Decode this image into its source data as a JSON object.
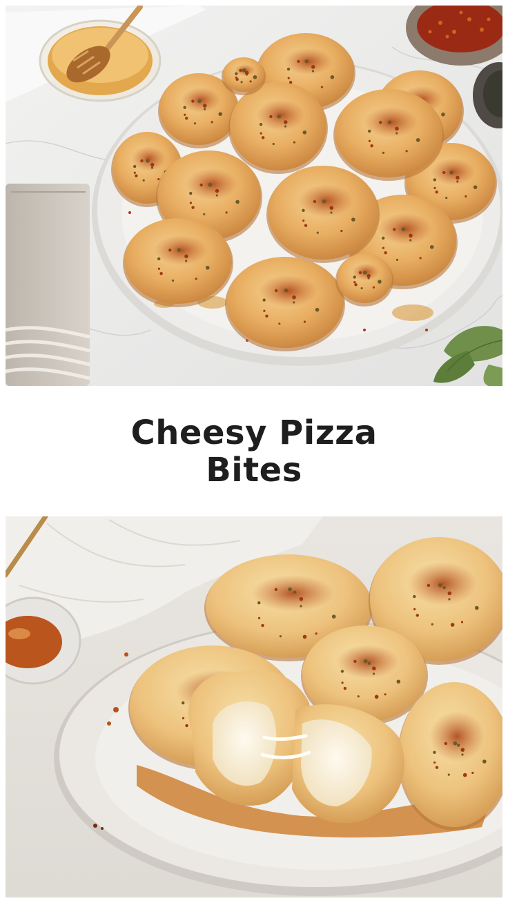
{
  "pin": {
    "title": "Cheesy Pizza Bites",
    "colors": {
      "background": "#ffffff",
      "title_text": "#1e1e1e",
      "bite_golden": "#e9b46a",
      "bite_charred": "#b5521c",
      "plate": "#ecebe8",
      "honey": "#c97a1c",
      "melted_cheese": "#fbf4e2"
    }
  },
  "top_photo": {
    "icons": [
      "honey-dipper-icon",
      "chili-flakes-icon",
      "oregano-leaf-icon",
      "linen-napkin-icon"
    ]
  },
  "bottom_photo": {
    "icons": [
      "honey-dip-bowl-icon",
      "linen-cloth-icon",
      "gold-utensil-icon"
    ]
  }
}
